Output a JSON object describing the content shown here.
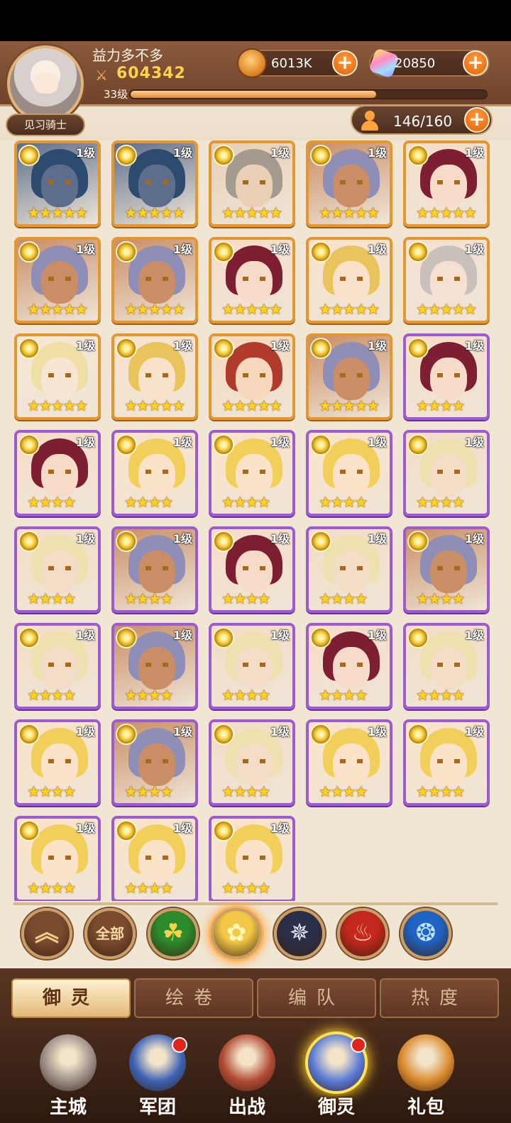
{
  "player": {
    "name": "益力多不多",
    "power": "604342",
    "level_label": "33级",
    "xp_fraction": 0.69,
    "rank": "见习骑士"
  },
  "resources": {
    "coins": {
      "icon": "gold-coin-icon",
      "value": "6013K",
      "add": "+"
    },
    "gems": {
      "icon": "crystal-gem-icon",
      "value": "20850",
      "add": "+"
    }
  },
  "capacity": {
    "icon": "person-icon",
    "value": "146/160",
    "add": "+"
  },
  "heroes": [
    {
      "level": "1级",
      "stars": "★★★★★",
      "rarity": "orange",
      "hair": "#2c4b6e",
      "skin": "#5d6e8c"
    },
    {
      "level": "1级",
      "stars": "★★★★★",
      "rarity": "orange",
      "hair": "#2c4b6e",
      "skin": "#5d6e8c"
    },
    {
      "level": "1级",
      "stars": "★★★★★",
      "rarity": "orange",
      "hair": "#a59a8e",
      "skin": "#e8cfb6"
    },
    {
      "level": "1级",
      "stars": "★★★★★",
      "rarity": "orange",
      "hair": "#8f8eb6",
      "skin": "#c98e66"
    },
    {
      "level": "1级",
      "stars": "★★★★★",
      "rarity": "orange",
      "hair": "#7e1e33",
      "skin": "#f6dcc8"
    },
    {
      "level": "1级",
      "stars": "★★★★★",
      "rarity": "orange",
      "hair": "#8f8eb6",
      "skin": "#c98e66"
    },
    {
      "level": "1级",
      "stars": "★★★★★",
      "rarity": "orange",
      "hair": "#8f8eb6",
      "skin": "#c98e66"
    },
    {
      "level": "1级",
      "stars": "★★★★★",
      "rarity": "orange",
      "hair": "#7e1e33",
      "skin": "#f6dcc8"
    },
    {
      "level": "1级",
      "stars": "★★★★★",
      "rarity": "orange",
      "hair": "#e9c35c",
      "skin": "#f8e2cc"
    },
    {
      "level": "1级",
      "stars": "★★★★★",
      "rarity": "orange",
      "hair": "#c9c0ba",
      "skin": "#f5e0d2"
    },
    {
      "level": "1级",
      "stars": "★★★★★",
      "rarity": "orange",
      "hair": "#f0dfa4",
      "skin": "#f7e6d4"
    },
    {
      "level": "1级",
      "stars": "★★★★★",
      "rarity": "orange",
      "hair": "#e9c35c",
      "skin": "#f8e2cc"
    },
    {
      "level": "1级",
      "stars": "★★★★★",
      "rarity": "orange",
      "hair": "#b23a2a",
      "skin": "#f6d8bd"
    },
    {
      "level": "1级",
      "stars": "★★★★★",
      "rarity": "orange",
      "hair": "#8f8eb6",
      "skin": "#c98e66"
    },
    {
      "level": "1级",
      "stars": "★★★★",
      "rarity": "purple",
      "hair": "#7e1e33",
      "skin": "#f6dcc8"
    },
    {
      "level": "1级",
      "stars": "★★★★",
      "rarity": "purple",
      "hair": "#7e1e33",
      "skin": "#f6dcc8"
    },
    {
      "level": "1级",
      "stars": "★★★★",
      "rarity": "purple",
      "hair": "#f2cf5a",
      "skin": "#fae3c8"
    },
    {
      "level": "1级",
      "stars": "★★★★",
      "rarity": "purple",
      "hair": "#f2cf5a",
      "skin": "#fae3c8"
    },
    {
      "level": "1级",
      "stars": "★★★★",
      "rarity": "purple",
      "hair": "#f2cf5a",
      "skin": "#fae3c8"
    },
    {
      "level": "1级",
      "stars": "★★★★",
      "rarity": "purple",
      "hair": "#efe0b0",
      "skin": "#f3ddc6"
    },
    {
      "level": "1级",
      "stars": "★★★★",
      "rarity": "purple",
      "hair": "#efe0b0",
      "skin": "#f3ddc6"
    },
    {
      "level": "1级",
      "stars": "★★★★",
      "rarity": "purple",
      "hair": "#8f8eb6",
      "skin": "#c98e66"
    },
    {
      "level": "1级",
      "stars": "★★★★",
      "rarity": "purple",
      "hair": "#7e1e33",
      "skin": "#f6dcc8"
    },
    {
      "level": "1级",
      "stars": "★★★★",
      "rarity": "purple",
      "hair": "#efe0b0",
      "skin": "#f3ddc6"
    },
    {
      "level": "1级",
      "stars": "★★★★",
      "rarity": "purple",
      "hair": "#8f8eb6",
      "skin": "#c98e66"
    },
    {
      "level": "1级",
      "stars": "★★★★",
      "rarity": "purple",
      "hair": "#efe0b0",
      "skin": "#f3ddc6"
    },
    {
      "level": "1级",
      "stars": "★★★★",
      "rarity": "purple",
      "hair": "#8f8eb6",
      "skin": "#c98e66"
    },
    {
      "level": "1级",
      "stars": "★★★★",
      "rarity": "purple",
      "hair": "#efe0b0",
      "skin": "#f3ddc6"
    },
    {
      "level": "1级",
      "stars": "★★★★",
      "rarity": "purple",
      "hair": "#7e1e33",
      "skin": "#f6dcc8"
    },
    {
      "level": "1级",
      "stars": "★★★★",
      "rarity": "purple",
      "hair": "#efe0b0",
      "skin": "#f3ddc6"
    },
    {
      "level": "1级",
      "stars": "★★★★",
      "rarity": "purple",
      "hair": "#f2cf5a",
      "skin": "#fae3c8"
    },
    {
      "level": "1级",
      "stars": "★★★★",
      "rarity": "purple",
      "hair": "#8f8eb6",
      "skin": "#c98e66"
    },
    {
      "level": "1级",
      "stars": "★★★★",
      "rarity": "purple",
      "hair": "#efe0b0",
      "skin": "#f3ddc6"
    },
    {
      "level": "1级",
      "stars": "★★★★",
      "rarity": "purple",
      "hair": "#f2cf5a",
      "skin": "#fae3c8"
    },
    {
      "level": "1级",
      "stars": "★★★★",
      "rarity": "purple",
      "hair": "#f2cf5a",
      "skin": "#fae3c8"
    },
    {
      "level": "1级",
      "stars": "★★★★",
      "rarity": "purple",
      "hair": "#f2cf5a",
      "skin": "#fae3c8"
    },
    {
      "level": "1级",
      "stars": "★★★★",
      "rarity": "purple",
      "hair": "#f2cf5a",
      "skin": "#fae3c8"
    },
    {
      "level": "1级",
      "stars": "★★★★",
      "rarity": "purple",
      "hair": "#f2cf5a",
      "skin": "#fae3c8"
    }
  ],
  "filters": [
    {
      "name": "collapse-filter-button",
      "icon": "double-chevron-up-icon",
      "label": "",
      "glyph": "︽",
      "bg": "#7b4b2e",
      "fg": "#f2cc8a"
    },
    {
      "name": "all-filter-button",
      "icon": "",
      "label": "全部",
      "glyph": "",
      "bg": "#7b4b2e",
      "fg": "#f5d9a6"
    },
    {
      "name": "nature-filter-button",
      "icon": "leaf-swirl-icon",
      "label": "",
      "glyph": "☘",
      "bg": "#2c8c2c",
      "fg": "#f4d24a"
    },
    {
      "name": "light-filter-button",
      "icon": "golden-rose-icon",
      "label": "",
      "glyph": "✿",
      "bg": "#f3c847",
      "fg": "#fff6b8"
    },
    {
      "name": "dark-filter-button",
      "icon": "dark-star-icon",
      "label": "",
      "glyph": "✵",
      "bg": "#2a2f4a",
      "fg": "#e6e8f6"
    },
    {
      "name": "fire-filter-button",
      "icon": "phoenix-icon",
      "label": "",
      "glyph": "♨",
      "bg": "#c4281c",
      "fg": "#ffc7a1"
    },
    {
      "name": "water-filter-button",
      "icon": "water-serpent-icon",
      "label": "",
      "glyph": "❂",
      "bg": "#1f64c4",
      "fg": "#bfe4ff"
    }
  ],
  "selected_filter": 3,
  "tabs": [
    {
      "label": "御灵",
      "active": true
    },
    {
      "label": "绘卷",
      "active": false
    },
    {
      "label": "编队",
      "active": false
    },
    {
      "label": "热度",
      "active": false
    }
  ],
  "nav": [
    {
      "label": "主城",
      "icon": "castle-icon",
      "badge": false,
      "active": false,
      "color": "#9a8d86"
    },
    {
      "label": "军团",
      "icon": "fist-shield-icon",
      "badge": true,
      "active": false,
      "color": "#3b62b3"
    },
    {
      "label": "出战",
      "icon": "sword-gate-icon",
      "badge": false,
      "active": false,
      "color": "#b24a33"
    },
    {
      "label": "御灵",
      "icon": "spirit-crystal-icon",
      "badge": true,
      "active": true,
      "color": "#5a7ad6"
    },
    {
      "label": "礼包",
      "icon": "gift-shop-icon",
      "badge": false,
      "active": false,
      "color": "#d98a2c"
    }
  ]
}
